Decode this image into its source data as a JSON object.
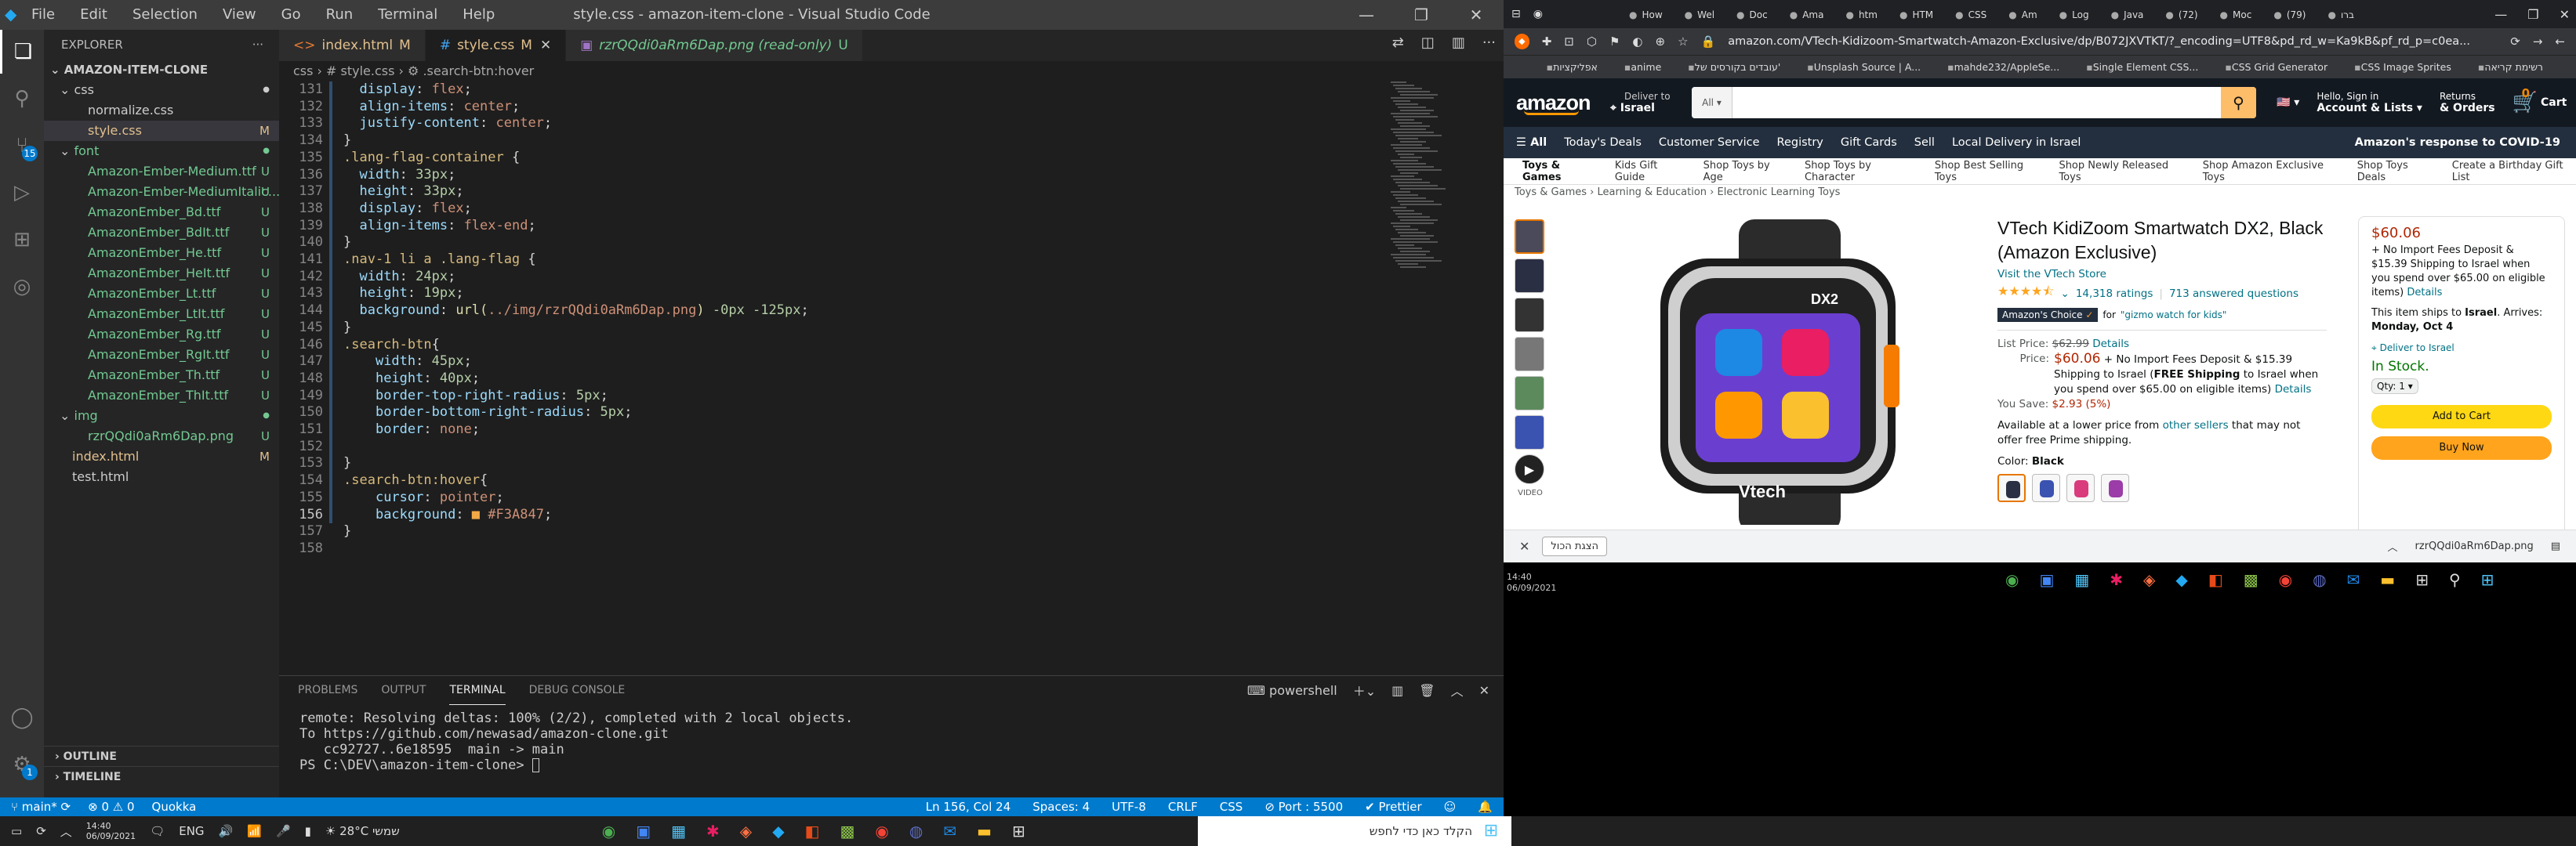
{
  "vscode": {
    "window_title": "style.css - amazon-item-clone - Visual Studio Code",
    "menu": [
      "File",
      "Edit",
      "Selection",
      "View",
      "Go",
      "Run",
      "Terminal",
      "Help"
    ],
    "explorer": {
      "title": "EXPLORER",
      "project": "AMAZON-ITEM-CLONE",
      "tree": [
        {
          "name": "css",
          "type": "folder",
          "depth": 1,
          "status": "",
          "color": "#cccccc"
        },
        {
          "name": "normalize.css",
          "type": "file",
          "depth": 2,
          "status": "",
          "color": "#cccccc"
        },
        {
          "name": "style.css",
          "type": "file",
          "depth": 2,
          "status": "M",
          "color": "#e2c08d",
          "selected": true
        },
        {
          "name": "font",
          "type": "folder",
          "depth": 1,
          "status": "",
          "color": "#73c991"
        },
        {
          "name": "Amazon-Ember-Medium.ttf",
          "type": "file",
          "depth": 2,
          "status": "U",
          "color": "#73c991"
        },
        {
          "name": "Amazon-Ember-MediumItalic....",
          "type": "file",
          "depth": 2,
          "status": "U",
          "color": "#73c991"
        },
        {
          "name": "AmazonEmber_Bd.ttf",
          "type": "file",
          "depth": 2,
          "status": "U",
          "color": "#73c991"
        },
        {
          "name": "AmazonEmber_BdIt.ttf",
          "type": "file",
          "depth": 2,
          "status": "U",
          "color": "#73c991"
        },
        {
          "name": "AmazonEmber_He.ttf",
          "type": "file",
          "depth": 2,
          "status": "U",
          "color": "#73c991"
        },
        {
          "name": "AmazonEmber_HeIt.ttf",
          "type": "file",
          "depth": 2,
          "status": "U",
          "color": "#73c991"
        },
        {
          "name": "AmazonEmber_Lt.ttf",
          "type": "file",
          "depth": 2,
          "status": "U",
          "color": "#73c991"
        },
        {
          "name": "AmazonEmber_LtIt.ttf",
          "type": "file",
          "depth": 2,
          "status": "U",
          "color": "#73c991"
        },
        {
          "name": "AmazonEmber_Rg.ttf",
          "type": "file",
          "depth": 2,
          "status": "U",
          "color": "#73c991"
        },
        {
          "name": "AmazonEmber_RgIt.ttf",
          "type": "file",
          "depth": 2,
          "status": "U",
          "color": "#73c991"
        },
        {
          "name": "AmazonEmber_Th.ttf",
          "type": "file",
          "depth": 2,
          "status": "U",
          "color": "#73c991"
        },
        {
          "name": "AmazonEmber_ThIt.ttf",
          "type": "file",
          "depth": 2,
          "status": "U",
          "color": "#73c991"
        },
        {
          "name": "img",
          "type": "folder",
          "depth": 1,
          "status": "",
          "color": "#73c991"
        },
        {
          "name": "rzrQQdi0aRm6Dap.png",
          "type": "file",
          "depth": 2,
          "status": "U",
          "color": "#73c991"
        },
        {
          "name": "index.html",
          "type": "file",
          "depth": 1,
          "status": "M",
          "color": "#e2c08d"
        },
        {
          "name": "test.html",
          "type": "file",
          "depth": 1,
          "status": "",
          "color": "#cccccc"
        }
      ],
      "outline": "OUTLINE",
      "timeline": "TIMELINE"
    },
    "tabs": [
      {
        "label": "index.html",
        "status": "M",
        "active": false
      },
      {
        "label": "style.css",
        "status": "M",
        "active": true
      },
      {
        "label": "rzrQQdi0aRm6Dap.png (read-only)",
        "status": "U",
        "active": false
      }
    ],
    "breadcrumb": "css › # style.css › ⚙ .search-btn:hover",
    "code_start": 131,
    "code_lines": [
      [
        [
          "  ",
          "#d4d4d4"
        ],
        [
          "display",
          "#9cdcfe"
        ],
        [
          ": ",
          "#d4d4d4"
        ],
        [
          "flex",
          "#ce9178"
        ],
        [
          ";",
          "#d4d4d4"
        ]
      ],
      [
        [
          "  ",
          "#d4d4d4"
        ],
        [
          "align-items",
          "#9cdcfe"
        ],
        [
          ": ",
          "#d4d4d4"
        ],
        [
          "center",
          "#ce9178"
        ],
        [
          ";",
          "#d4d4d4"
        ]
      ],
      [
        [
          "  ",
          "#d4d4d4"
        ],
        [
          "justify-content",
          "#9cdcfe"
        ],
        [
          ": ",
          "#d4d4d4"
        ],
        [
          "center",
          "#ce9178"
        ],
        [
          ";",
          "#d4d4d4"
        ]
      ],
      [
        [
          "}",
          "#d4d4d4"
        ]
      ],
      [
        [
          ".lang-flag-container",
          "#d7ba7d"
        ],
        [
          " {",
          "#d4d4d4"
        ]
      ],
      [
        [
          "  ",
          "#d4d4d4"
        ],
        [
          "width",
          "#9cdcfe"
        ],
        [
          ": ",
          "#d4d4d4"
        ],
        [
          "33px",
          "#b5cea8"
        ],
        [
          ";",
          "#d4d4d4"
        ]
      ],
      [
        [
          "  ",
          "#d4d4d4"
        ],
        [
          "height",
          "#9cdcfe"
        ],
        [
          ": ",
          "#d4d4d4"
        ],
        [
          "33px",
          "#b5cea8"
        ],
        [
          ";",
          "#d4d4d4"
        ]
      ],
      [
        [
          "  ",
          "#d4d4d4"
        ],
        [
          "display",
          "#9cdcfe"
        ],
        [
          ": ",
          "#d4d4d4"
        ],
        [
          "flex",
          "#ce9178"
        ],
        [
          ";",
          "#d4d4d4"
        ]
      ],
      [
        [
          "  ",
          "#d4d4d4"
        ],
        [
          "align-items",
          "#9cdcfe"
        ],
        [
          ": ",
          "#d4d4d4"
        ],
        [
          "flex-end",
          "#ce9178"
        ],
        [
          ";",
          "#d4d4d4"
        ]
      ],
      [
        [
          "}",
          "#d4d4d4"
        ]
      ],
      [
        [
          ".nav-1 li a .lang-flag",
          "#d7ba7d"
        ],
        [
          " {",
          "#d4d4d4"
        ]
      ],
      [
        [
          "  ",
          "#d4d4d4"
        ],
        [
          "width",
          "#9cdcfe"
        ],
        [
          ": ",
          "#d4d4d4"
        ],
        [
          "24px",
          "#b5cea8"
        ],
        [
          ";",
          "#d4d4d4"
        ]
      ],
      [
        [
          "  ",
          "#d4d4d4"
        ],
        [
          "height",
          "#9cdcfe"
        ],
        [
          ": ",
          "#d4d4d4"
        ],
        [
          "19px",
          "#b5cea8"
        ],
        [
          ";",
          "#d4d4d4"
        ]
      ],
      [
        [
          "  ",
          "#d4d4d4"
        ],
        [
          "background",
          "#9cdcfe"
        ],
        [
          ": ",
          "#d4d4d4"
        ],
        [
          "url(",
          "#dcdcaa"
        ],
        [
          "../img/rzrQQdi0aRm6Dap.png",
          "#ce9178"
        ],
        [
          ")",
          "#dcdcaa"
        ],
        [
          " -0px -125px",
          "#b5cea8"
        ],
        [
          ";",
          "#d4d4d4"
        ]
      ],
      [
        [
          "}",
          "#d4d4d4"
        ]
      ],
      [
        [
          ".search-btn",
          "#d7ba7d"
        ],
        [
          "{",
          "#d4d4d4"
        ]
      ],
      [
        [
          "    ",
          "#d4d4d4"
        ],
        [
          "width",
          "#9cdcfe"
        ],
        [
          ": ",
          "#d4d4d4"
        ],
        [
          "45px",
          "#b5cea8"
        ],
        [
          ";",
          "#d4d4d4"
        ]
      ],
      [
        [
          "    ",
          "#d4d4d4"
        ],
        [
          "height",
          "#9cdcfe"
        ],
        [
          ": ",
          "#d4d4d4"
        ],
        [
          "40px",
          "#b5cea8"
        ],
        [
          ";",
          "#d4d4d4"
        ]
      ],
      [
        [
          "    ",
          "#d4d4d4"
        ],
        [
          "border-top-right-radius",
          "#9cdcfe"
        ],
        [
          ": ",
          "#d4d4d4"
        ],
        [
          "5px",
          "#b5cea8"
        ],
        [
          ";",
          "#d4d4d4"
        ]
      ],
      [
        [
          "    ",
          "#d4d4d4"
        ],
        [
          "border-bottom-right-radius",
          "#9cdcfe"
        ],
        [
          ": ",
          "#d4d4d4"
        ],
        [
          "5px",
          "#b5cea8"
        ],
        [
          ";",
          "#d4d4d4"
        ]
      ],
      [
        [
          "    ",
          "#d4d4d4"
        ],
        [
          "border",
          "#9cdcfe"
        ],
        [
          ": ",
          "#d4d4d4"
        ],
        [
          "none",
          "#ce9178"
        ],
        [
          ";",
          "#d4d4d4"
        ]
      ],
      [
        [
          "",
          "#d4d4d4"
        ]
      ],
      [
        [
          "}",
          "#d4d4d4"
        ]
      ],
      [
        [
          ".search-btn:hover",
          "#d7ba7d"
        ],
        [
          "{",
          "#d4d4d4"
        ]
      ],
      [
        [
          "    ",
          "#d4d4d4"
        ],
        [
          "cursor",
          "#9cdcfe"
        ],
        [
          ": ",
          "#d4d4d4"
        ],
        [
          "pointer",
          "#ce9178"
        ],
        [
          ";",
          "#d4d4d4"
        ]
      ],
      [
        [
          "    ",
          "#d4d4d4"
        ],
        [
          "background",
          "#9cdcfe"
        ],
        [
          ": ",
          "#d4d4d4"
        ],
        [
          "■ ",
          "#f3a847"
        ],
        [
          "#F3A847",
          "#ce9178"
        ],
        [
          ";",
          "#d4d4d4"
        ]
      ],
      [
        [
          "}",
          "#d4d4d4"
        ]
      ],
      [
        [
          "",
          "#d4d4d4"
        ]
      ]
    ],
    "panel_tabs": [
      "PROBLEMS",
      "OUTPUT",
      "TERMINAL",
      "DEBUG CONSOLE"
    ],
    "terminal_shell": "powershell",
    "terminal_lines": [
      "remote: Resolving deltas: 100% (2/2), completed with 2 local objects.",
      "To https://github.com/newasad/amazon-clone.git",
      "   cc92727..6e18595  main -> main",
      "PS C:\\DEV\\amazon-item-clone> "
    ],
    "status": {
      "branch": "main*",
      "problems": "⊗ 0 ⚠ 0",
      "quokka": "Quokka",
      "position": "Ln 156, Col 24",
      "spaces": "Spaces: 4",
      "encoding": "UTF-8",
      "eol": "CRLF",
      "lang": "CSS",
      "port": "⊘ Port : 5500",
      "prettier": "✔ Prettier"
    }
  },
  "taskbar": {
    "weather": "28°C",
    "weather_text": "שמשי",
    "lang": "ENG",
    "time": "14:40",
    "date": "06/09/2021",
    "search_placeholder": "הקלד כאן כדי לחפש"
  },
  "chrome": {
    "url": "amazon.com/VTech-Kidizoom-Smartwatch-Amazon-Exclusive/dp/B072JXVTKT/?_encoding=UTF8&pd_rd_w=Ka9kB&pf_rd_p=c0ea...",
    "bookmarks": [
      "רשימת קריאה",
      "CSS Image Sprites",
      "CSS Grid Generator",
      "Single Element CSS...",
      "mahde232/AppleSe...",
      "Unsplash Source | A...",
      "עובדים בקורסים של'",
      "anime",
      "אפליקציות"
    ],
    "download_file": "rzrQQdi0aRm6Dap.png",
    "download_button": "הצגת הכול"
  },
  "amazon": {
    "logo": "amazon",
    "deliver_small": "Deliver to",
    "deliver_country": "Israel",
    "search_cat": "All",
    "signin_small": "Hello, Sign in",
    "signin_big": "Account & Lists",
    "returns_small": "Returns",
    "returns_big": "& Orders",
    "cart_count": "0",
    "cart_label": "Cart",
    "nav": [
      "All",
      "Today's Deals",
      "Customer Service",
      "Registry",
      "Gift Cards",
      "Sell",
      "Local Delivery in Israel"
    ],
    "nav_right": "Amazon's response to COVID-19",
    "subnav": [
      "Toys & Games",
      "Kids Gift Guide",
      "Shop Toys by Age",
      "Shop Toys by Character",
      "Shop Best Selling Toys",
      "Shop Newly Released Toys",
      "Shop Amazon Exclusive Toys",
      "Shop Toys Deals",
      "Create a Birthday Gift List"
    ],
    "crumb": "Toys & Games  ›  Learning & Education  ›  Electronic Learning Toys",
    "video_label": "VIDEO",
    "watch_brand_label": "DX2",
    "watch_logo": "Vtech",
    "title": "VTech KidiZoom Smartwatch DX2, Black (Amazon Exclusive)",
    "store_link": "Visit the VTech Store",
    "stars": 4.6,
    "ratings": "14,318 ratings",
    "answered": "713 answered questions",
    "choice_label": "Amazon's Choice",
    "choice_for": "for",
    "choice_query": "\"gizmo watch for kids\"",
    "list_price_label": "List Price:",
    "list_price": "$62.99",
    "details": "Details",
    "price_label": "Price:",
    "price": "$60.06",
    "price_note": " + No Import Fees Deposit & $15.39 Shipping to Israel (",
    "free_shipping": "FREE Shipping",
    "price_note2": " to Israel when you spend over $65.00 on eligible items) ",
    "save_label": "You Save:",
    "save": "$2.93 (5%)",
    "other_text": "Available at a lower price from ",
    "other_link": "other sellers",
    "other_text2": " that may not offer free Prime shipping.",
    "color_label": "Color:",
    "color_value": "Black",
    "swatches": [
      "#2a2f44",
      "#3a52b0",
      "#d93b7c",
      "#9b3ca8"
    ],
    "buybox": {
      "price": "$60.06",
      "note1": "+ No Import Fees Deposit & $15.39 Shipping to Israel when you spend over $65.00 on eligible items) ",
      "details": "Details",
      "ships_a": "This item ships to ",
      "ships_b": "Israel",
      "ships_c": ". Arrives: ",
      "arrives": "Monday, Oct 4",
      "deliver_to": "Deliver to Israel",
      "stock": "In Stock.",
      "qty": "Qty: 1",
      "add": "Add to Cart",
      "buy": "Buy Now"
    }
  }
}
